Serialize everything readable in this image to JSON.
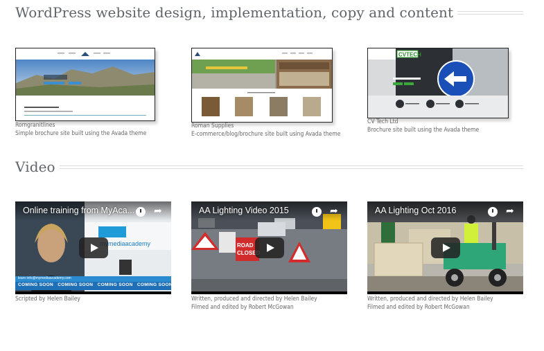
{
  "sections": {
    "web": {
      "title": "WordPress website design, implementation, copy and content"
    },
    "video": {
      "title": "Video"
    }
  },
  "sites": [
    {
      "name": "Romgranitlines",
      "desc": "Simple brochure site built using the Avada theme",
      "hero_line1": "Romgranit Lines",
      "hero_line2": "Romgranit Lines, Romania",
      "hero_line3": "Suppliers and Exporters of Natural Stone"
    },
    {
      "name": "Roman Supplies",
      "desc": "E-commerce/blog/brochure site built using Avada theme",
      "banner": "Give your Garden Beauty For Spring/Summer",
      "products_label": "Featured Products"
    },
    {
      "name": "CV Tech Ltd",
      "desc": "Brochure site built using the Avada theme",
      "logo": "CVTECH",
      "banner": "LIT AND UNLIT SIGNS",
      "services": [
        "INSTALLATION",
        "ENGINEERING",
        "CONSULTING"
      ]
    }
  ],
  "videos": [
    {
      "title": "Online training from MyAca...",
      "credit1": "Scripted by Helen Bailey",
      "credit2": "",
      "brand": "mymediaacademy",
      "email": "learn info@mymediaacademy.com",
      "ticker": "COMING SOON"
    },
    {
      "title": "AA Lighting Video 2015",
      "credit1": "Written, produced and directed by Helen Bailey",
      "credit2": "Filmed and edited by Robert McGowan",
      "sign": "ROAD CLOSED"
    },
    {
      "title": "AA Lighting Oct 2016",
      "credit1": "Written, produced and directed by Helen Bailey",
      "credit2": "Filmed and edited by Robert McGowan"
    }
  ],
  "colors": {
    "heading": "#5f6569",
    "caption": "#666666",
    "separator": "#dcdcdc"
  },
  "icons": [
    "clock-icon",
    "share-icon",
    "play-icon"
  ]
}
